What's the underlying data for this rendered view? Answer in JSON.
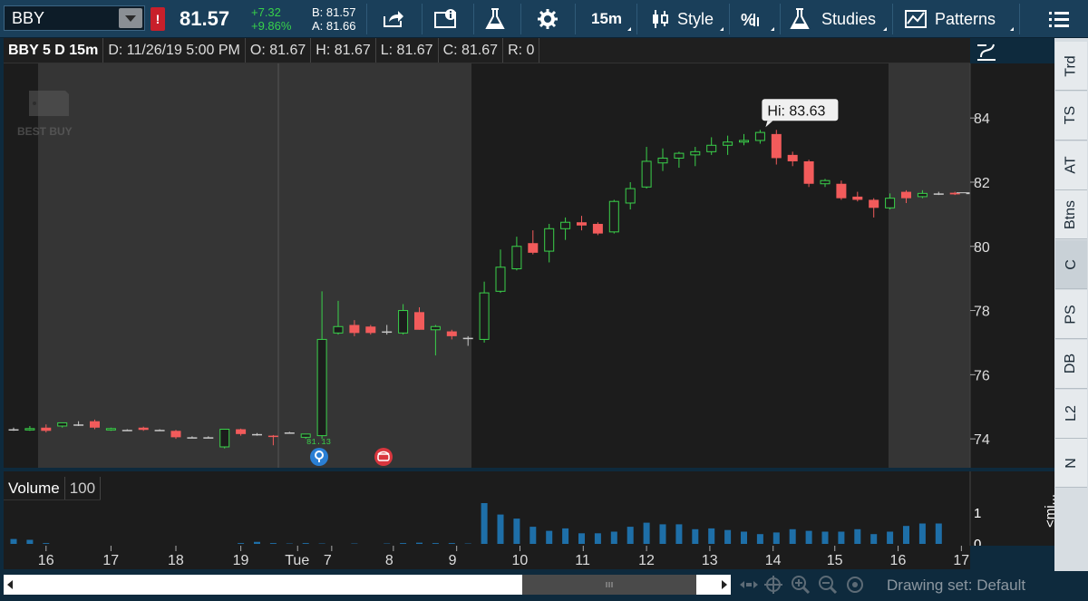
{
  "toolbar": {
    "symbol": "BBY",
    "alert_badge": "!",
    "last_price": "81.57",
    "net_change": "+7.32",
    "pct_change": "+9.86%",
    "bid": "B: 81.57",
    "ask": "A: 81.66",
    "timeframe_label": "15m",
    "style_label": "Style",
    "studies_label": "Studies",
    "patterns_label": "Patterns"
  },
  "chart_header": {
    "title": "BBY 5 D 15m",
    "date": "D: 11/26/19 5:00 PM",
    "open": "O: 81.67",
    "high": "H: 81.67",
    "low": "L: 81.67",
    "close": "C: 81.67",
    "range": "R: 0"
  },
  "watermark": "BEST BUY",
  "right_tabs": [
    "Trd",
    "TS",
    "AT",
    "Btns",
    "C",
    "PS",
    "DB",
    "L2",
    "N"
  ],
  "volume_panel": {
    "label": "Volume",
    "value": "100",
    "scale_top": "1",
    "scale_bottom": "0"
  },
  "bottom": {
    "drawing_set": "Drawing set: Default",
    "mini_label": "<mi..."
  },
  "chart_data": {
    "type": "candlestick",
    "title": "BBY 5 D 15m",
    "ylim": [
      73.1,
      85.7
    ],
    "y_ticks": [
      74,
      76,
      78,
      80,
      82,
      84
    ],
    "current_price": "81.67",
    "high_label": "Hi: 83.63",
    "low_label": "81.13",
    "x_ticks": [
      {
        "label": "16",
        "i": 2
      },
      {
        "label": "17",
        "i": 6
      },
      {
        "label": "18",
        "i": 10
      },
      {
        "label": "19",
        "i": 14
      },
      {
        "label": "Tue",
        "i": 17.5
      },
      {
        "label": "7",
        "i": 19.6
      },
      {
        "label": "8",
        "i": 23.4
      },
      {
        "label": "9",
        "i": 27.3
      },
      {
        "label": "10",
        "i": 31.2
      },
      {
        "label": "11",
        "i": 35.1
      },
      {
        "label": "12",
        "i": 39
      },
      {
        "label": "13",
        "i": 42.9
      },
      {
        "label": "14",
        "i": 46.8
      },
      {
        "label": "15",
        "i": 50.6
      },
      {
        "label": "16",
        "i": 54.5
      },
      {
        "label": "17",
        "i": 58.4
      }
    ],
    "candles": [
      {
        "o": 74.3,
        "h": 74.35,
        "l": 74.25,
        "c": 74.3
      },
      {
        "o": 74.3,
        "h": 74.4,
        "l": 74.25,
        "c": 74.32
      },
      {
        "o": 74.35,
        "h": 74.45,
        "l": 74.2,
        "c": 74.25
      },
      {
        "o": 74.4,
        "h": 74.5,
        "l": 74.35,
        "c": 74.5
      },
      {
        "o": 74.45,
        "h": 74.55,
        "l": 74.4,
        "c": 74.45
      },
      {
        "o": 74.55,
        "h": 74.6,
        "l": 74.3,
        "c": 74.35
      },
      {
        "o": 74.3,
        "h": 74.35,
        "l": 74.25,
        "c": 74.32
      },
      {
        "o": 74.28,
        "h": 74.3,
        "l": 74.25,
        "c": 74.28
      },
      {
        "o": 74.35,
        "h": 74.38,
        "l": 74.25,
        "c": 74.28
      },
      {
        "o": 74.28,
        "h": 74.3,
        "l": 74.25,
        "c": 74.28
      },
      {
        "o": 74.25,
        "h": 74.28,
        "l": 74.0,
        "c": 74.05
      },
      {
        "o": 74.05,
        "h": 74.08,
        "l": 74.02,
        "c": 74.05
      },
      {
        "o": 74.05,
        "h": 74.08,
        "l": 74.02,
        "c": 74.05
      },
      {
        "o": 73.75,
        "h": 74.3,
        "l": 73.7,
        "c": 74.3
      },
      {
        "o": 74.3,
        "h": 74.32,
        "l": 74.1,
        "c": 74.15
      },
      {
        "o": 74.15,
        "h": 74.18,
        "l": 74.1,
        "c": 74.15
      },
      {
        "o": 74.1,
        "h": 74.12,
        "l": 73.8,
        "c": 74.08
      },
      {
        "o": 74.2,
        "h": 74.22,
        "l": 74.18,
        "c": 74.2
      },
      {
        "o": 74.05,
        "h": 74.15,
        "l": 74.0,
        "c": 74.15
      },
      {
        "o": 74.1,
        "h": 78.6,
        "l": 74.0,
        "c": 77.1
      },
      {
        "o": 77.3,
        "h": 78.3,
        "l": 77.25,
        "c": 77.5
      },
      {
        "o": 77.55,
        "h": 77.7,
        "l": 77.2,
        "c": 77.3
      },
      {
        "o": 77.5,
        "h": 77.55,
        "l": 77.25,
        "c": 77.3
      },
      {
        "o": 77.35,
        "h": 77.55,
        "l": 77.25,
        "c": 77.35
      },
      {
        "o": 77.3,
        "h": 78.2,
        "l": 77.25,
        "c": 78.0
      },
      {
        "o": 77.95,
        "h": 78.1,
        "l": 77.4,
        "c": 77.4
      },
      {
        "o": 77.4,
        "h": 77.55,
        "l": 76.6,
        "c": 77.5
      },
      {
        "o": 77.35,
        "h": 77.4,
        "l": 77.1,
        "c": 77.2
      },
      {
        "o": 77.15,
        "h": 77.2,
        "l": 76.9,
        "c": 77.15
      },
      {
        "o": 77.1,
        "h": 78.9,
        "l": 77.0,
        "c": 78.55
      },
      {
        "o": 78.6,
        "h": 79.9,
        "l": 78.55,
        "c": 79.35
      },
      {
        "o": 79.3,
        "h": 80.3,
        "l": 79.25,
        "c": 80.0
      },
      {
        "o": 80.1,
        "h": 80.5,
        "l": 79.75,
        "c": 79.8
      },
      {
        "o": 79.85,
        "h": 80.7,
        "l": 79.5,
        "c": 80.55
      },
      {
        "o": 80.55,
        "h": 80.9,
        "l": 80.2,
        "c": 80.75
      },
      {
        "o": 80.75,
        "h": 80.95,
        "l": 80.5,
        "c": 80.65
      },
      {
        "o": 80.7,
        "h": 80.75,
        "l": 80.35,
        "c": 80.4
      },
      {
        "o": 80.45,
        "h": 81.45,
        "l": 80.4,
        "c": 81.4
      },
      {
        "o": 81.35,
        "h": 82.0,
        "l": 81.15,
        "c": 81.8
      },
      {
        "o": 81.85,
        "h": 83.1,
        "l": 81.8,
        "c": 82.65
      },
      {
        "o": 82.6,
        "h": 83.05,
        "l": 82.35,
        "c": 82.75
      },
      {
        "o": 82.75,
        "h": 82.95,
        "l": 82.45,
        "c": 82.9
      },
      {
        "o": 82.85,
        "h": 83.1,
        "l": 82.5,
        "c": 82.95
      },
      {
        "o": 82.95,
        "h": 83.4,
        "l": 82.85,
        "c": 83.15
      },
      {
        "o": 83.15,
        "h": 83.45,
        "l": 82.85,
        "c": 83.25
      },
      {
        "o": 83.25,
        "h": 83.5,
        "l": 83.15,
        "c": 83.3
      },
      {
        "o": 83.3,
        "h": 83.63,
        "l": 83.2,
        "c": 83.55
      },
      {
        "o": 83.5,
        "h": 83.63,
        "l": 82.55,
        "c": 82.75
      },
      {
        "o": 82.85,
        "h": 82.95,
        "l": 82.5,
        "c": 82.65
      },
      {
        "o": 82.65,
        "h": 82.7,
        "l": 81.85,
        "c": 81.95
      },
      {
        "o": 81.95,
        "h": 82.1,
        "l": 81.85,
        "c": 82.05
      },
      {
        "o": 81.95,
        "h": 82.05,
        "l": 81.45,
        "c": 81.5
      },
      {
        "o": 81.55,
        "h": 81.7,
        "l": 81.4,
        "c": 81.45
      },
      {
        "o": 81.45,
        "h": 81.5,
        "l": 80.9,
        "c": 81.2
      },
      {
        "o": 81.2,
        "h": 81.65,
        "l": 81.15,
        "c": 81.5
      },
      {
        "o": 81.7,
        "h": 81.75,
        "l": 81.35,
        "c": 81.5
      },
      {
        "o": 81.55,
        "h": 81.75,
        "l": 81.5,
        "c": 81.65
      },
      {
        "o": 81.65,
        "h": 81.7,
        "l": 81.6,
        "c": 81.65
      },
      {
        "o": 81.67,
        "h": 81.7,
        "l": 81.6,
        "c": 81.62
      },
      {
        "o": 81.67,
        "h": 81.67,
        "l": 81.67,
        "c": 81.67
      }
    ],
    "volume": [
      0.12,
      0.1,
      0.02,
      0,
      0,
      0,
      0,
      0,
      0,
      0,
      0,
      0,
      0,
      0,
      0.02,
      0.05,
      0.02,
      0.01,
      0.02,
      0.01,
      0,
      0.01,
      0,
      0.01,
      0.02,
      0.03,
      0.02,
      0.02,
      0.01,
      1.0,
      0.72,
      0.62,
      0.42,
      0.32,
      0.38,
      0.26,
      0.26,
      0.3,
      0.42,
      0.52,
      0.48,
      0.48,
      0.36,
      0.38,
      0.34,
      0.3,
      0.24,
      0.28,
      0.36,
      0.32,
      0.3,
      0.3,
      0.36,
      0.24,
      0.3,
      0.44,
      0.5,
      0.5,
      0,
      0
    ],
    "colors": {
      "up": "#3ad14a",
      "down": "#f25b5b",
      "neutral": "#c8c8c8"
    }
  }
}
